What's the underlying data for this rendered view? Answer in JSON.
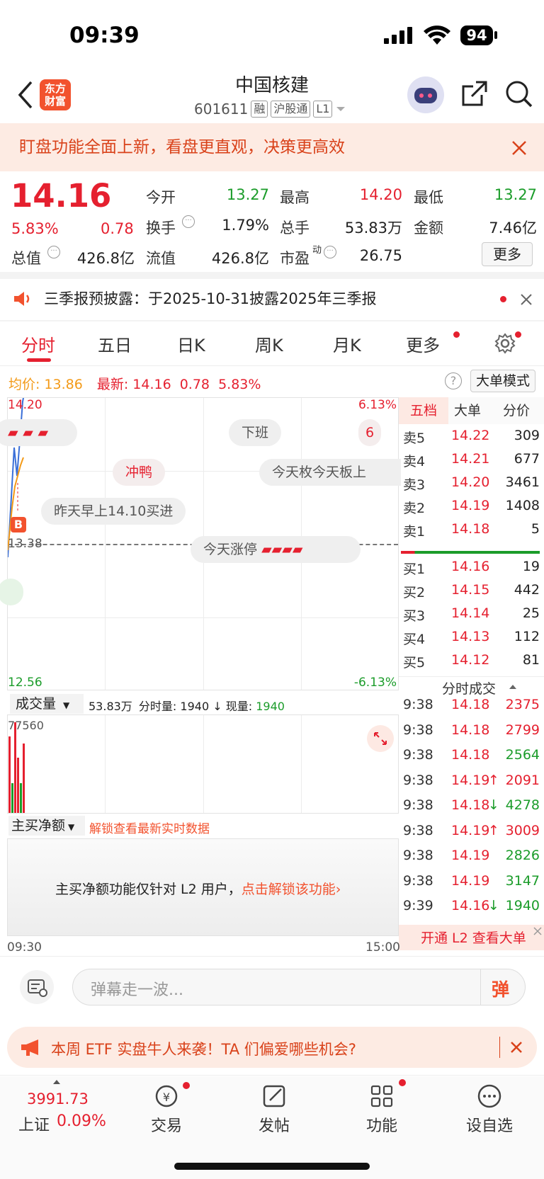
{
  "status": {
    "time": "09:39",
    "battery": "94"
  },
  "header": {
    "logo_text": "东方\n财富",
    "title": "中国核建",
    "code": "601611",
    "tags": [
      "融",
      "沪股通",
      "L1"
    ]
  },
  "banner": {
    "text": "盯盘功能全面上新，看盘更直观，决策更高效"
  },
  "quote": {
    "price": "14.16",
    "change_pct": "5.83%",
    "change": "0.78",
    "open_label": "今开",
    "open": "13.27",
    "high_label": "最高",
    "high": "14.20",
    "low_label": "最低",
    "low": "13.27",
    "turnover_label": "换手",
    "turnover": "1.79%",
    "volume_label": "总手",
    "volume": "53.83万",
    "amount_label": "金额",
    "amount": "7.46亿",
    "mktcap_label": "总值",
    "mktcap": "426.8亿",
    "float_label": "流值",
    "float": "426.8亿",
    "pe_label": "市盈",
    "pe_sup": "动",
    "pe": "26.75",
    "more": "更多"
  },
  "announcement": {
    "text": "三季报预披露：于2025-10-31披露2025年三季报"
  },
  "tabs": [
    "分时",
    "五日",
    "日K",
    "周K",
    "月K",
    "更多"
  ],
  "chart": {
    "avg_label": "均价:",
    "avg": "13.86",
    "latest_label": "最新:",
    "latest": "14.16",
    "latest_chg": "0.78",
    "latest_pct": "5.83%",
    "mode_button": "大单模式",
    "y_top": "14.20",
    "y_mid": "13.38",
    "y_bottom": "12.56",
    "pct_top": "6.13%",
    "pct_bottom": "-6.13%",
    "b_marker": "B",
    "time_start": "09:30",
    "time_end": "15:00"
  },
  "danmaku": [
    "冲鸭",
    "下班",
    "今天枚今天板上",
    "昨天早上14.10买进",
    "今天涨停",
    "6"
  ],
  "order_tabs": [
    "五档",
    "大单",
    "分价"
  ],
  "asks": [
    {
      "label": "卖5",
      "price": "14.22",
      "qty": "309"
    },
    {
      "label": "卖4",
      "price": "14.21",
      "qty": "677"
    },
    {
      "label": "卖3",
      "price": "14.20",
      "qty": "3461"
    },
    {
      "label": "卖2",
      "price": "14.19",
      "qty": "1408"
    },
    {
      "label": "卖1",
      "price": "14.18",
      "qty": "5"
    }
  ],
  "bids": [
    {
      "label": "买1",
      "price": "14.16",
      "qty": "19"
    },
    {
      "label": "买2",
      "price": "14.15",
      "qty": "442"
    },
    {
      "label": "买3",
      "price": "14.14",
      "qty": "25"
    },
    {
      "label": "买4",
      "price": "14.13",
      "qty": "112"
    },
    {
      "label": "买5",
      "price": "14.12",
      "qty": "81"
    }
  ],
  "ticks_title": "分时成交",
  "ticks": [
    {
      "time": "9:38",
      "price": "14.18",
      "qty": "2375",
      "dir": "",
      "qty_color": "red"
    },
    {
      "time": "9:38",
      "price": "14.18",
      "qty": "2799",
      "dir": "",
      "qty_color": "red"
    },
    {
      "time": "9:38",
      "price": "14.18",
      "qty": "2564",
      "dir": "",
      "qty_color": "green"
    },
    {
      "time": "9:38",
      "price": "14.19",
      "qty": "2091",
      "dir": "↑",
      "qty_color": "red"
    },
    {
      "time": "9:38",
      "price": "14.18",
      "qty": "4278",
      "dir": "↓",
      "qty_color": "green"
    },
    {
      "time": "9:38",
      "price": "14.19",
      "qty": "3009",
      "dir": "↑",
      "qty_color": "red"
    },
    {
      "time": "9:38",
      "price": "14.19",
      "qty": "2826",
      "dir": "",
      "qty_color": "green"
    },
    {
      "time": "9:38",
      "price": "14.19",
      "qty": "3147",
      "dir": "",
      "qty_color": "green"
    },
    {
      "time": "9:39",
      "price": "14.16",
      "qty": "1940",
      "dir": "↓",
      "qty_color": "green"
    }
  ],
  "l2_promo": "开通 L2 查看大单",
  "volume_panel": {
    "selector": "成交量",
    "total": "53.83万",
    "minute_label": "分时量:",
    "minute": "1940",
    "arrow": "↓",
    "current_label": "现量:",
    "current": "1940",
    "y_top": "77560"
  },
  "net_panel": {
    "selector": "主买净额",
    "unlock": "解锁查看最新实时数据",
    "message": "主买净额功能仅针对 L2 用户，",
    "link": "点击解锁该功能"
  },
  "comment": {
    "placeholder": "弹幕走一波...",
    "send": "弹"
  },
  "ad": {
    "text": "本周 ETF 实盘牛人来袭！TA 们偏爱哪些机会?"
  },
  "bottom_nav": {
    "index_value": "3991.73",
    "index_name": "上证",
    "index_pct": "0.09%",
    "trade": "交易",
    "post": "发帖",
    "func": "功能",
    "watch": "设自选"
  },
  "colors": {
    "up": "#e5202f",
    "down": "#1b9c2a",
    "avg_line": "#f39a18",
    "price_line": "#3a6fd8"
  }
}
